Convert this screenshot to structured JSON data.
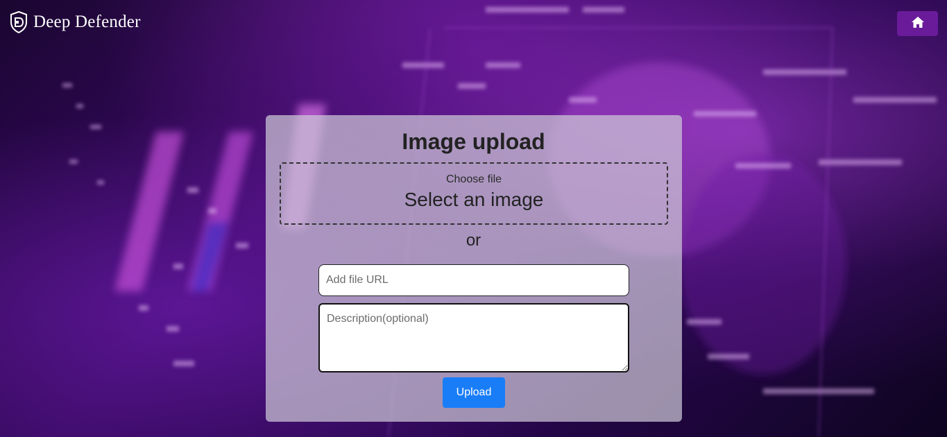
{
  "colors": {
    "accent_purple": "#6a1b9a",
    "upload_blue": "#1a7df8",
    "card_overlay": "#cdc8d7"
  },
  "navbar": {
    "brand_text": "Deep Defender",
    "brand_icon": "shield-logo-icon",
    "home_icon": "home-icon"
  },
  "upload_card": {
    "title": "Image upload",
    "dropzone": {
      "choose_label": "Choose file",
      "select_text": "Select an image"
    },
    "or_text": "or",
    "url_input": {
      "placeholder": "Add file URL",
      "value": ""
    },
    "description_input": {
      "placeholder": "Description(optional)",
      "value": ""
    },
    "upload_button_label": "Upload"
  }
}
